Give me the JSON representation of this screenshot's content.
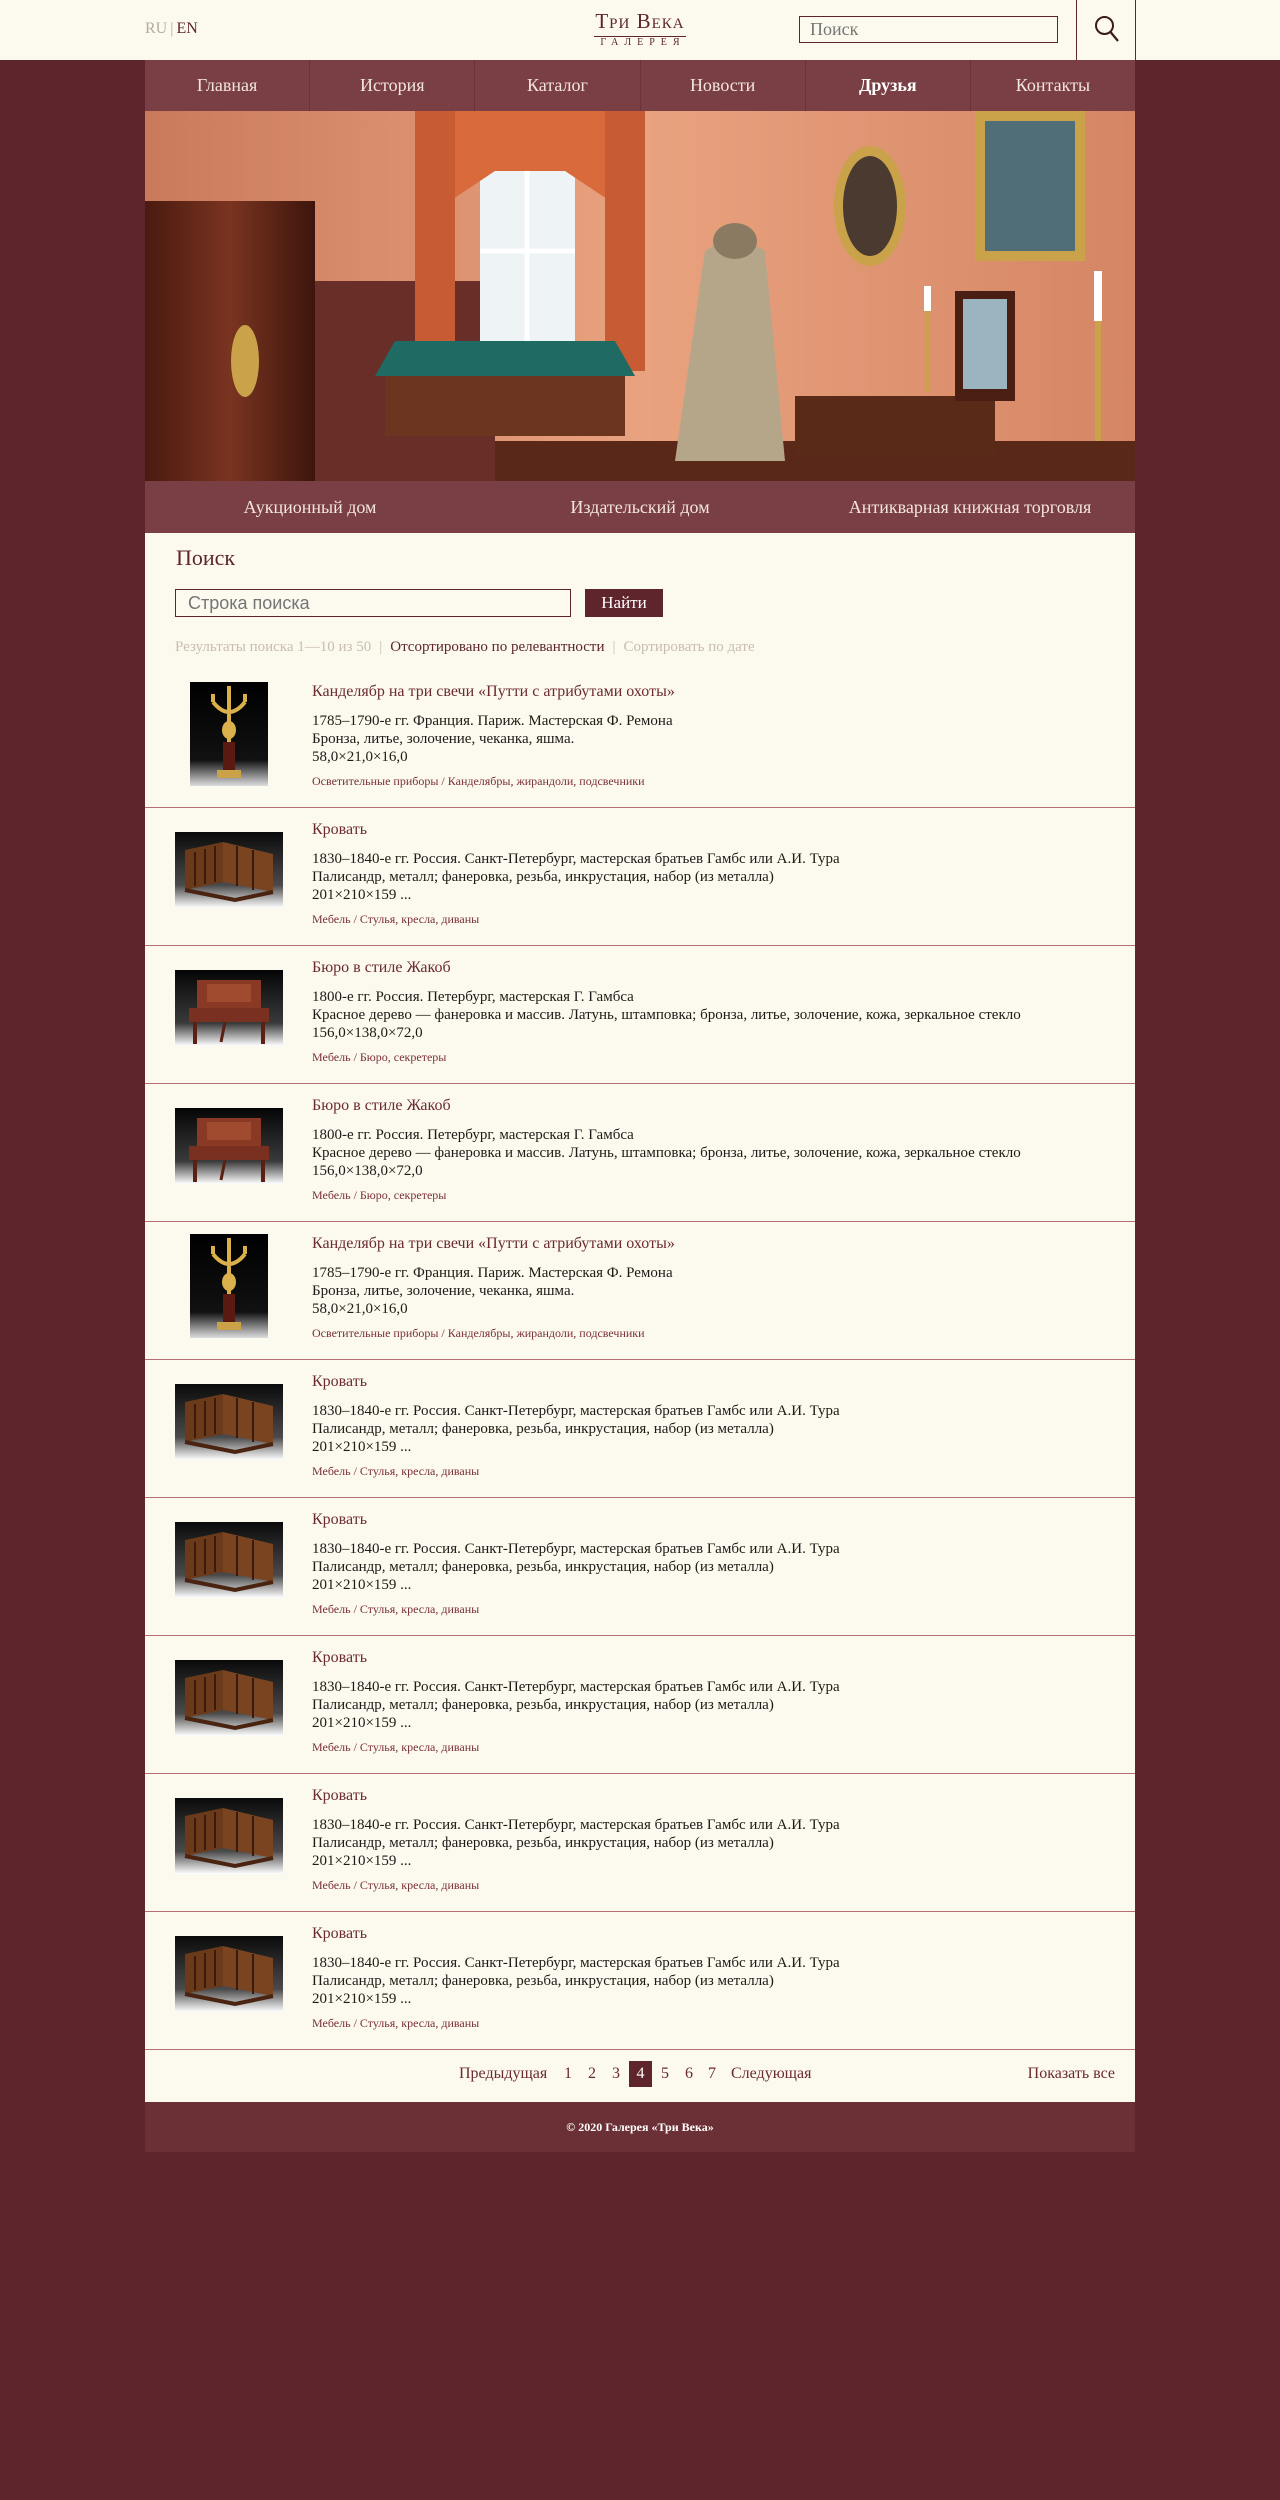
{
  "header": {
    "lang_ru": "RU",
    "lang_sep": "|",
    "lang_en": "EN",
    "logo_line1": "Три Века",
    "logo_line2": "ГАЛЕРЕЯ",
    "search_placeholder": "Поиск"
  },
  "nav": [
    {
      "label": "Главная"
    },
    {
      "label": "История"
    },
    {
      "label": "Каталог"
    },
    {
      "label": "Новости"
    },
    {
      "label": "Друзья"
    },
    {
      "label": "Контакты"
    }
  ],
  "subnav": [
    {
      "label": "Аукционный дом"
    },
    {
      "label": "Издательский дом"
    },
    {
      "label": "Антикварная книжная торговля"
    }
  ],
  "search": {
    "title": "Поиск",
    "input_placeholder": "Строка поиска",
    "button": "Найти",
    "results_text": "Результаты поиска 1—10 из 50",
    "sort_relevance": "Отсортировано по релевантности",
    "sort_date": "Сортировать по дате",
    "sep": "|"
  },
  "results": [
    {
      "title": "Канделябр на три свечи «Путти с атрибутами охоты»",
      "date": "1785–1790-е гг. Франция. Париж. Мастерская Ф. Ремона",
      "materials": "Бронза, литье, золочение, чеканка, яшма.",
      "size": "58,0×21,0×16,0",
      "category": "Осветительные приборы / Канделябры, жирандоли, подсвечники",
      "thumb": "candelabrum"
    },
    {
      "title": "Кровать",
      "date": "1830–1840-е гг. Россия. Санкт-Петербург, мастерская братьев Гамбс или А.И. Тура",
      "materials": "Палисандр, металл; фанеровка, резьба, инкрустация, набор (из металла)",
      "size": "201×210×159 ...",
      "category": "Мебель / Стулья, кресла, диваны",
      "thumb": "bed"
    },
    {
      "title": "Бюро в стиле Жакоб",
      "date": "1800-е гг. Россия. Петербург, мастерская Г. Гамбса",
      "materials": "Красное дерево — фанеровка и массив. Латунь, штамповка; бронза, литье, золочение, кожа, зеркальное стекло",
      "size": "156,0×138,0×72,0",
      "category": "Мебель / Бюро, секретеры",
      "thumb": "bureau"
    },
    {
      "title": "Бюро в стиле Жакоб",
      "date": "1800-е гг. Россия. Петербург, мастерская Г. Гамбса",
      "materials": "Красное дерево — фанеровка и массив. Латунь, штамповка; бронза, литье, золочение, кожа, зеркальное стекло",
      "size": "156,0×138,0×72,0",
      "category": "Мебель / Бюро, секретеры",
      "thumb": "bureau"
    },
    {
      "title": "Канделябр на три свечи «Путти с атрибутами охоты»",
      "date": "1785–1790-е гг. Франция. Париж. Мастерская Ф. Ремона",
      "materials": "Бронза, литье, золочение, чеканка, яшма.",
      "size": "58,0×21,0×16,0",
      "category": "Осветительные приборы / Канделябры, жирандоли, подсвечники",
      "thumb": "candelabrum"
    },
    {
      "title": "Кровать",
      "date": "1830–1840-е гг. Россия. Санкт-Петербург, мастерская братьев Гамбс или А.И. Тура",
      "materials": "Палисандр, металл; фанеровка, резьба, инкрустация, набор (из металла)",
      "size": "201×210×159 ...",
      "category": "Мебель / Стулья, кресла, диваны",
      "thumb": "bed"
    },
    {
      "title": "Кровать",
      "date": "1830–1840-е гг. Россия. Санкт-Петербург, мастерская братьев Гамбс или А.И. Тура",
      "materials": "Палисандр, металл; фанеровка, резьба, инкрустация, набор (из металла)",
      "size": "201×210×159 ...",
      "category": "Мебель / Стулья, кресла, диваны",
      "thumb": "bed"
    },
    {
      "title": "Кровать",
      "date": "1830–1840-е гг. Россия. Санкт-Петербург, мастерская братьев Гамбс или А.И. Тура",
      "materials": "Палисандр, металл; фанеровка, резьба, инкрустация, набор (из металла)",
      "size": "201×210×159 ...",
      "category": "Мебель / Стулья, кресла, диваны",
      "thumb": "bed"
    },
    {
      "title": "Кровать",
      "date": "1830–1840-е гг. Россия. Санкт-Петербург, мастерская братьев Гамбс или А.И. Тура",
      "materials": "Палисандр, металл; фанеровка, резьба, инкрустация, набор (из металла)",
      "size": "201×210×159 ...",
      "category": "Мебель / Стулья, кресла, диваны",
      "thumb": "bed"
    },
    {
      "title": "Кровать",
      "date": "1830–1840-е гг. Россия. Санкт-Петербург, мастерская братьев Гамбс или А.И. Тура",
      "materials": "Палисандр, металл; фанеровка, резьба, инкрустация, набор (из металла)",
      "size": "201×210×159 ...",
      "category": "Мебель / Стулья, кресла, диваны",
      "thumb": "bed"
    }
  ],
  "pagination": {
    "prev": "Предыдущая",
    "pages": [
      "1",
      "2",
      "3",
      "4",
      "5",
      "6",
      "7"
    ],
    "current": "4",
    "next": "Следующая",
    "show_all": "Показать все"
  },
  "slider": {
    "count": 5,
    "active": 1
  },
  "footer": {
    "text": "© 2020 Галерея «Три Века»"
  },
  "colors": {
    "brand": "#5e262c",
    "nav": "#7a3f44",
    "paper": "#fcf9ef"
  }
}
